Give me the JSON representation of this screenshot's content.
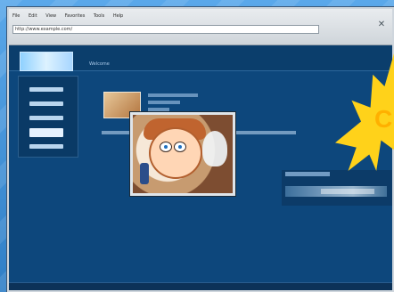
{
  "browser": {
    "menu_items": [
      "File",
      "Edit",
      "View",
      "Favorites",
      "Tools",
      "Help"
    ],
    "address": "http://www.example.com/",
    "tool_glyph": "✕"
  },
  "site": {
    "header_text": "Welcome",
    "sidebar_items": [
      "",
      "",
      "",
      "",
      ""
    ]
  },
  "overlay": {
    "letter": "C"
  },
  "colors": {
    "accent": "#ffd21a",
    "page_bg": "#0d477c",
    "chrome_bg": "#e9ecef"
  }
}
